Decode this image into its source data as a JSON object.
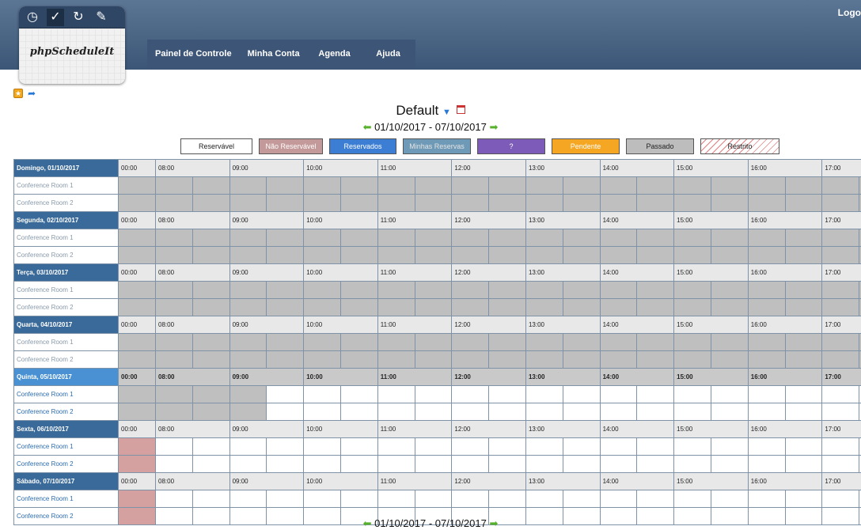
{
  "header": {
    "logout_label": "Logo",
    "app_name": "phpScheduleIt",
    "nav": [
      "Painel de Controle",
      "Minha Conta",
      "Agenda",
      "Ajuda"
    ]
  },
  "schedule": {
    "title": "Default",
    "date_range": "01/10/2017 - 07/10/2017"
  },
  "legend": [
    "Reservável",
    "Não Reservável",
    "Reservados",
    "Minhas Reservas",
    "?",
    "Pendente",
    "Passado",
    "Restrito"
  ],
  "times": [
    "00:00",
    "08:00",
    "09:00",
    "10:00",
    "11:00",
    "12:00",
    "13:00",
    "14:00",
    "15:00",
    "16:00",
    "17:00"
  ],
  "resources": [
    "Conference Room 1",
    "Conference Room 2"
  ],
  "days": [
    {
      "label": "Domingo, 01/10/2017",
      "status": "past"
    },
    {
      "label": "Segunda, 02/10/2017",
      "status": "past"
    },
    {
      "label": "Terça, 03/10/2017",
      "status": "past"
    },
    {
      "label": "Quarta, 04/10/2017",
      "status": "past"
    },
    {
      "label": "Quinta, 05/10/2017",
      "status": "today"
    },
    {
      "label": "Sexta, 06/10/2017",
      "status": "future"
    },
    {
      "label": "Sábado, 07/10/2017",
      "status": "future"
    }
  ],
  "colors": {
    "header": "#3d5576",
    "day_header": "#3a6a99",
    "today_header": "#4a91d4",
    "past": "#bfbfbf",
    "not_reservable": "#d4a0a0"
  }
}
